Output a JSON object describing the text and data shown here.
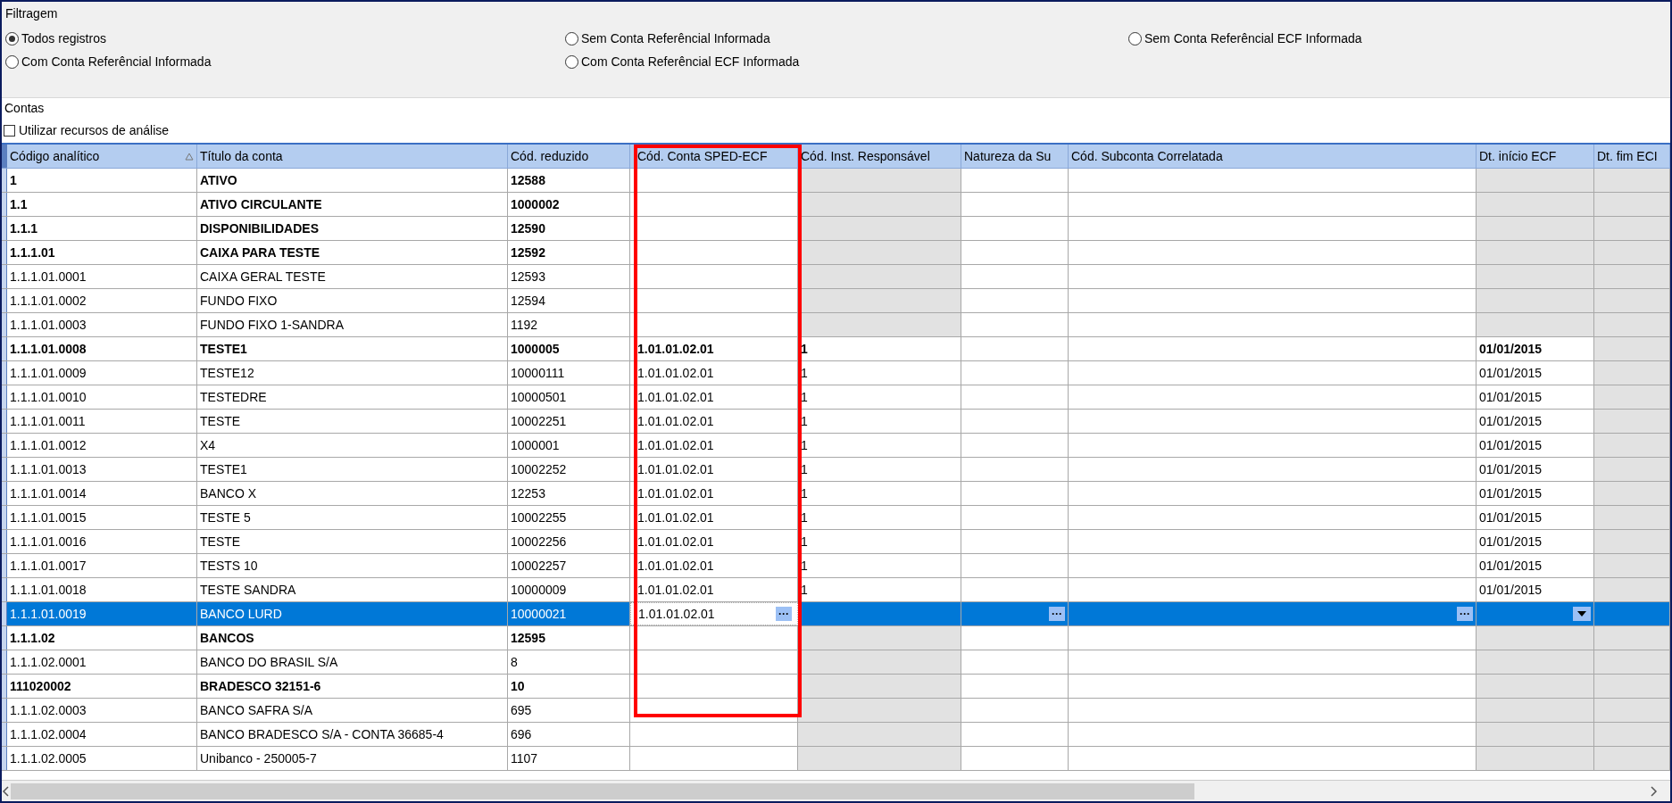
{
  "filter": {
    "title": "Filtragem",
    "options": [
      {
        "label": "Todos registros",
        "selected": true
      },
      {
        "label": "Sem Conta Referêncial Informada",
        "selected": false
      },
      {
        "label": "Sem Conta Referêncial ECF Informada",
        "selected": false
      },
      {
        "label": "Com Conta Referêncial Informada",
        "selected": false
      },
      {
        "label": "Com Conta Referêncial ECF Informada",
        "selected": false
      }
    ]
  },
  "accounts": {
    "title": "Contas",
    "analysis": {
      "label": "Utilizar recursos de análise",
      "checked": false
    }
  },
  "table": {
    "ellipsis_label": "···",
    "columns": [
      {
        "label": "Código analítico",
        "sorted": true,
        "kind": "plain"
      },
      {
        "label": "Título da conta",
        "sorted": false,
        "kind": "plain"
      },
      {
        "label": "Cód. reduzido",
        "sorted": false,
        "kind": "plain"
      },
      {
        "label": "Cód. Conta SPED-ECF",
        "sorted": false,
        "kind": "ellipsis"
      },
      {
        "label": "Cód. Inst. Responsável",
        "sorted": false,
        "shaded": true,
        "kind": "plain"
      },
      {
        "label": "Natureza da Su",
        "sorted": false,
        "shaded": false,
        "kind": "ellipsis"
      },
      {
        "label": "Cód. Subconta Correlatada",
        "sorted": false,
        "shaded": false,
        "kind": "ellipsis"
      },
      {
        "label": "Dt. início ECF",
        "sorted": false,
        "shaded": true,
        "kind": "dropdown"
      },
      {
        "label": "Dt. fim ECI",
        "sorted": false,
        "shaded": true,
        "kind": "plain"
      }
    ],
    "rows": [
      {
        "bold": true,
        "selected": false,
        "code": "1",
        "title": "ATIVO",
        "reduced": "12588"
      },
      {
        "bold": true,
        "selected": false,
        "code": "1.1",
        "title": "ATIVO CIRCULANTE",
        "reduced": "1000002"
      },
      {
        "bold": true,
        "selected": false,
        "code": "1.1.1",
        "title": "DISPONIBILIDADES",
        "reduced": "12590"
      },
      {
        "bold": true,
        "selected": false,
        "code": "1.1.1.01",
        "title": "CAIXA PARA TESTE",
        "reduced": "12592"
      },
      {
        "bold": false,
        "selected": false,
        "code": "1.1.1.01.0001",
        "title": "CAIXA GERAL TESTE",
        "reduced": "12593"
      },
      {
        "bold": false,
        "selected": false,
        "code": "1.1.1.01.0002",
        "title": "FUNDO FIXO",
        "reduced": "12594"
      },
      {
        "bold": false,
        "selected": false,
        "code": "1.1.1.01.0003",
        "title": "FUNDO FIXO 1-SANDRA",
        "reduced": "1192"
      },
      {
        "bold": true,
        "selected": false,
        "code": "1.1.1.01.0008",
        "title": "TESTE1",
        "reduced": "1000005",
        "sped": "1.01.01.02.01",
        "inst": "1",
        "start": "01/01/2015"
      },
      {
        "bold": false,
        "selected": false,
        "code": "1.1.1.01.0009",
        "title": "TESTE12",
        "reduced": "10000111",
        "sped": "1.01.01.02.01",
        "inst": "1",
        "start": "01/01/2015"
      },
      {
        "bold": false,
        "selected": false,
        "code": "1.1.1.01.0010",
        "title": "TESTEDRE",
        "reduced": "10000501",
        "sped": "1.01.01.02.01",
        "inst": "1",
        "start": "01/01/2015"
      },
      {
        "bold": false,
        "selected": false,
        "code": "1.1.1.01.0011",
        "title": "TESTE",
        "reduced": "10002251",
        "sped": "1.01.01.02.01",
        "inst": "1",
        "start": "01/01/2015"
      },
      {
        "bold": false,
        "selected": false,
        "code": "1.1.1.01.0012",
        "title": "X4",
        "reduced": "1000001",
        "sped": "1.01.01.02.01",
        "inst": "1",
        "start": "01/01/2015"
      },
      {
        "bold": false,
        "selected": false,
        "code": "1.1.1.01.0013",
        "title": "TESTE1",
        "reduced": "10002252",
        "sped": "1.01.01.02.01",
        "inst": "1",
        "start": "01/01/2015"
      },
      {
        "bold": false,
        "selected": false,
        "code": "1.1.1.01.0014",
        "title": "BANCO X",
        "reduced": "12253",
        "sped": "1.01.01.02.01",
        "inst": "1",
        "start": "01/01/2015"
      },
      {
        "bold": false,
        "selected": false,
        "code": "1.1.1.01.0015",
        "title": "TESTE 5",
        "reduced": "10002255",
        "sped": "1.01.01.02.01",
        "inst": "1",
        "start": "01/01/2015"
      },
      {
        "bold": false,
        "selected": false,
        "code": "1.1.1.01.0016",
        "title": "TESTE",
        "reduced": "10002256",
        "sped": "1.01.01.02.01",
        "inst": "1",
        "start": "01/01/2015"
      },
      {
        "bold": false,
        "selected": false,
        "code": "1.1.1.01.0017",
        "title": "TESTS 10",
        "reduced": "10002257",
        "sped": "1.01.01.02.01",
        "inst": "1",
        "start": "01/01/2015"
      },
      {
        "bold": false,
        "selected": false,
        "code": "1.1.1.01.0018",
        "title": "TESTE SANDRA",
        "reduced": "10000009",
        "sped": "1.01.01.02.01",
        "inst": "1",
        "start": "01/01/2015"
      },
      {
        "bold": false,
        "selected": true,
        "code": "1.1.1.01.0019",
        "title": "BANCO LURD",
        "reduced": "10000021",
        "sped": "1.01.01.02.01"
      },
      {
        "bold": true,
        "selected": false,
        "code": "1.1.1.02",
        "title": "BANCOS",
        "reduced": "12595"
      },
      {
        "bold": false,
        "selected": false,
        "code": "1.1.1.02.0001",
        "title": "BANCO DO BRASIL S/A",
        "reduced": "8"
      },
      {
        "bold": true,
        "selected": false,
        "code": "111020002",
        "title": "BRADESCO 32151-6",
        "reduced": "10"
      },
      {
        "bold": false,
        "selected": false,
        "code": "1.1.1.02.0003",
        "title": "BANCO SAFRA S/A",
        "reduced": "695"
      },
      {
        "bold": false,
        "selected": false,
        "code": "1.1.1.02.0004",
        "title": "BANCO BRADESCO S/A - CONTA 36685-4",
        "reduced": "696"
      },
      {
        "bold": false,
        "selected": false,
        "code": "1.1.1.02.0005",
        "title": "Unibanco - 250005-7",
        "reduced": "1107"
      }
    ]
  }
}
